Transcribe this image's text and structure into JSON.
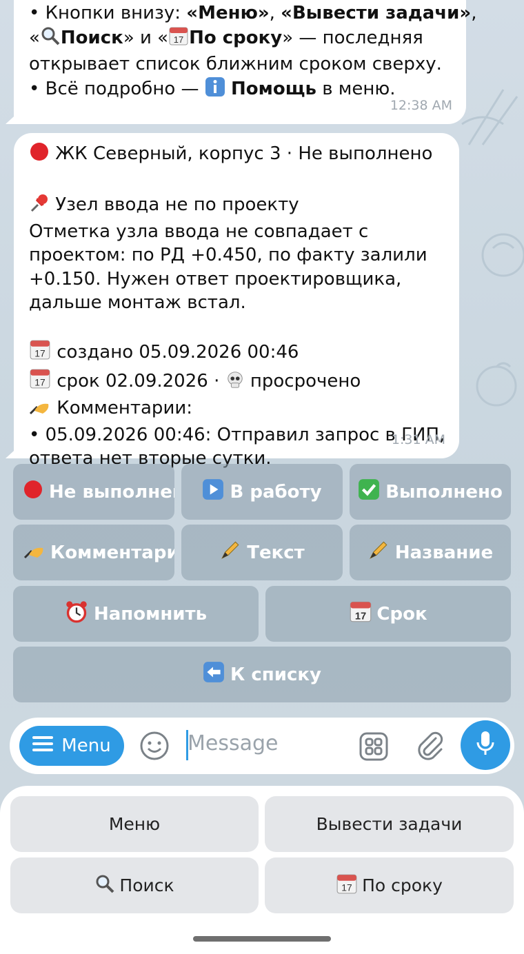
{
  "message_1": {
    "lines": [
      {
        "parts": [
          "• Кнопки внизу: ",
          "«Меню»",
          ", ",
          "«Вывести задачи»",
          ","
        ]
      },
      {
        "parts": [
          "«",
          "Поиск",
          "» и «",
          "По сроку",
          "» — последняя"
        ]
      },
      {
        "parts": [
          "открывает список ближним сроком сверху."
        ]
      },
      {
        "parts": [
          "• Всё подробно — ",
          "Помощь",
          " в меню."
        ]
      }
    ],
    "time": "12:38 AM"
  },
  "message_2": {
    "header": "ЖК Северный, корпус 3 · Не выполнено",
    "task_title": "Узел ввода не по проекту",
    "description_lines": [
      "Отметка узла ввода не совпадает с",
      "проектом: по РД +0.450, по факту залили",
      "+0.150. Нужен ответ проектировщика,",
      "дальше монтаж встал."
    ],
    "created": "создано 05.09.2026 00:46",
    "deadline": "срок 02.09.2026 ·",
    "overdue": "просрочено",
    "comments_label": "Комментарии:",
    "comment_lines": [
      "• 05.09.2026 00:46: Отправил запрос в ГИП,",
      "ответа нет вторые сутки."
    ],
    "time": "1:31 AM"
  },
  "inline_keyboard": {
    "not_done": "Не выполнено",
    "in_work": "В работу",
    "done": "Выполнено",
    "comments": "Комментарии",
    "text": "Текст",
    "name": "Название",
    "remind": "Напомнить",
    "deadline": "Срок",
    "back": "К списку"
  },
  "input_bar": {
    "menu_label": "Menu",
    "placeholder": "Message"
  },
  "reply_keyboard": {
    "menu": "Меню",
    "show_tasks": "Вывести задачи",
    "search": "Поиск",
    "by_deadline": "По сроку"
  },
  "colors": {
    "accent": "#2f9be4",
    "chat_bg": "#cfdbe4",
    "status_red": "#e0242b"
  }
}
